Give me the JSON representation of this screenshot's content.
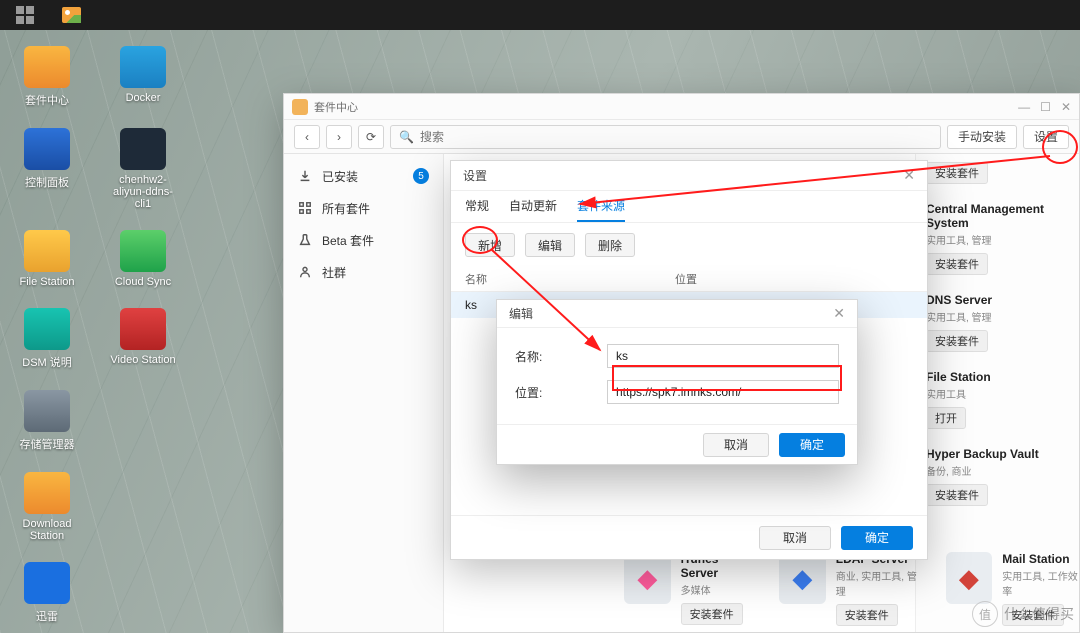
{
  "desktop_icons": [
    {
      "label": "套件中心",
      "cls": "bag"
    },
    {
      "label": "Docker",
      "cls": "whale"
    },
    {
      "label": "控制面板",
      "cls": "panel"
    },
    {
      "label": "chenhw2-aliyun-ddns-cli1",
      "cls": "dkr"
    },
    {
      "label": "File Station",
      "cls": "folder"
    },
    {
      "label": "Cloud Sync",
      "cls": "cloud"
    },
    {
      "label": "DSM 说明",
      "cls": "q"
    },
    {
      "label": "Video Station",
      "cls": "play"
    },
    {
      "label": "存储管理器",
      "cls": "db"
    },
    {
      "label": "",
      "cls": ""
    },
    {
      "label": "Download Station",
      "cls": "dl"
    },
    {
      "label": "",
      "cls": ""
    },
    {
      "label": "迅雷",
      "cls": "bird"
    }
  ],
  "pkwin": {
    "title": "套件中心",
    "search_placeholder": "搜索",
    "manual_install": "手动安装",
    "settings": "设置",
    "sidebar": [
      {
        "label": "已安装",
        "badge": "5",
        "icon": "download"
      },
      {
        "label": "所有套件",
        "icon": "grid"
      },
      {
        "label": "Beta 套件",
        "icon": "beta"
      },
      {
        "label": "社群",
        "icon": "community"
      }
    ],
    "right": [
      {
        "title": "",
        "sub": "",
        "button": "安装套件"
      },
      {
        "title": "Central Management System",
        "sub": "实用工具, 管理",
        "button": "安装套件"
      },
      {
        "title": "DNS Server",
        "sub": "实用工具, 管理",
        "button": "安装套件"
      },
      {
        "title": "File Station",
        "sub": "实用工具",
        "button": "打开"
      },
      {
        "title": "Hyper Backup Vault",
        "sub": "备份, 商业",
        "button": "安装套件"
      }
    ],
    "bottom": [
      {
        "name": "iTunes Server",
        "cat": "多媒体",
        "btn": "安装套件",
        "col": "#ff5c9c"
      },
      {
        "name": "LDAP Server",
        "cat": "商业, 实用工具, 管理",
        "btn": "安装套件",
        "col": "#3a7df0"
      },
      {
        "name": "Mail Station",
        "cat": "实用工具, 工作效率",
        "btn": "安装套件",
        "col": "#d2433a"
      }
    ]
  },
  "modal1": {
    "title": "设置",
    "tabs": [
      "常规",
      "自动更新",
      "套件来源"
    ],
    "active_tab": 2,
    "buttons": [
      "新增",
      "编辑",
      "删除"
    ],
    "col_name": "名称",
    "col_loc": "位置",
    "row_name": "ks",
    "row_loc": "https://spk7.imnks.com/",
    "cancel": "取消",
    "ok": "确定"
  },
  "modal2": {
    "title": "编辑",
    "name_label": "名称:",
    "loc_label": "位置:",
    "name_val": "ks",
    "loc_val": "https://spk7.imnks.com/",
    "cancel": "取消",
    "ok": "确定"
  },
  "watermark": "什么值得买"
}
